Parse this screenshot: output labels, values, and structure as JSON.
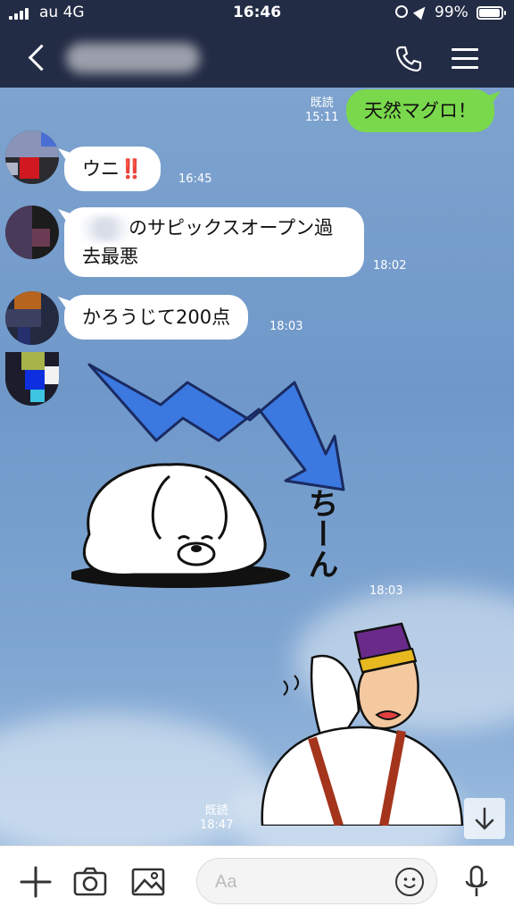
{
  "status_bar": {
    "carrier": "au 4G",
    "time": "16:46",
    "battery": "99%"
  },
  "header": {
    "back_icon": "chevron-left-icon",
    "call_icon": "phone-icon",
    "menu_icon": "hamburger-menu-icon"
  },
  "messages": [
    {
      "direction": "out",
      "text": "天然マグロ！",
      "read": "既読",
      "time": "15:11"
    },
    {
      "direction": "in",
      "text": "ウニ",
      "emoji": "‼️",
      "time": "16:45"
    },
    {
      "direction": "in",
      "text_line1": "のサピックスオープン過",
      "text_line2": "去最悪",
      "time": "18:02"
    },
    {
      "direction": "in",
      "text": "かろうじて200点",
      "time": "18:03"
    },
    {
      "direction": "in",
      "type": "sticker",
      "caption": "ちーん",
      "time": "18:03"
    },
    {
      "direction": "out",
      "type": "sticker",
      "read": "既読",
      "time": "18:47"
    }
  ],
  "input": {
    "placeholder": "Aa"
  },
  "colors": {
    "header_bg": "#232c45",
    "outgoing_bubble": "#7ad84c",
    "incoming_bubble": "#ffffff",
    "chat_bg": "#7ea3cf"
  }
}
